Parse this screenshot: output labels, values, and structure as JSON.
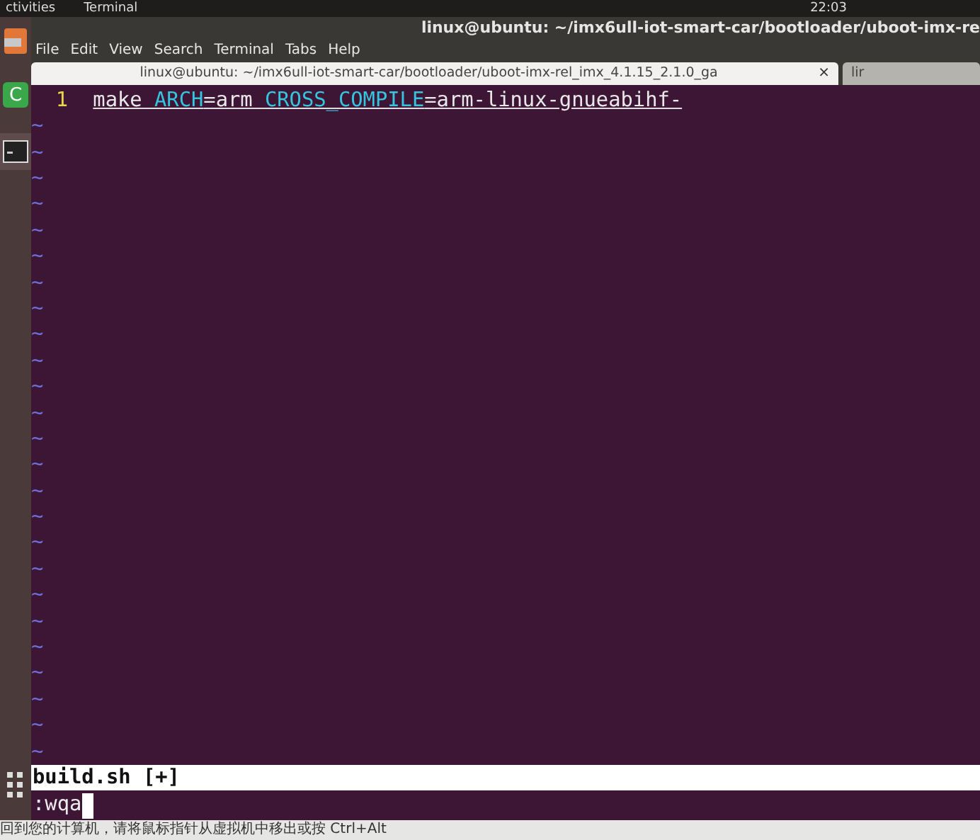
{
  "top_bar": {
    "activities": "ctivities",
    "app_menu": "Terminal",
    "clock": "22:03"
  },
  "window": {
    "title": "linux@ubuntu: ~/imx6ull-iot-smart-car/bootloader/uboot-imx-re"
  },
  "menu": [
    "File",
    "Edit",
    "View",
    "Search",
    "Terminal",
    "Tabs",
    "Help"
  ],
  "tabs": [
    {
      "label": "linux@ubuntu: ~/imx6ull-iot-smart-car/bootloader/uboot-imx-rel_imx_4.1.15_2.1.0_ga",
      "selected": true,
      "close": "×"
    },
    {
      "label": "lir",
      "selected": false
    }
  ],
  "dock": [
    {
      "kind": "files"
    },
    {
      "kind": "code",
      "label": "C"
    },
    {
      "kind": "terminal",
      "selected": true
    },
    {
      "kind": "apps"
    }
  ],
  "editor": {
    "lines": [
      {
        "number": "1",
        "tokens": [
          {
            "text": "make ",
            "kind": "plain"
          },
          {
            "text": "ARCH",
            "kind": "identifier"
          },
          {
            "text": "=arm ",
            "kind": "plain"
          },
          {
            "text": "CROSS_COMPILE",
            "kind": "identifier"
          },
          {
            "text": "=arm-linux-gnueabihf-",
            "kind": "plain"
          }
        ]
      }
    ],
    "filler": [
      "~",
      "~",
      "~",
      "~",
      "~",
      "~",
      "~",
      "~",
      "~",
      "~",
      "~",
      "~",
      "~",
      "~",
      "~",
      "~",
      "~",
      "~",
      "~",
      "~",
      "~",
      "~",
      "~",
      "~",
      "~"
    ],
    "status_line": "build.sh [+]",
    "command_line": ":wqa"
  },
  "vm_hint": "回到您的计算机，请将鼠标指针从虚拟机中移出或按 Ctrl+Alt"
}
